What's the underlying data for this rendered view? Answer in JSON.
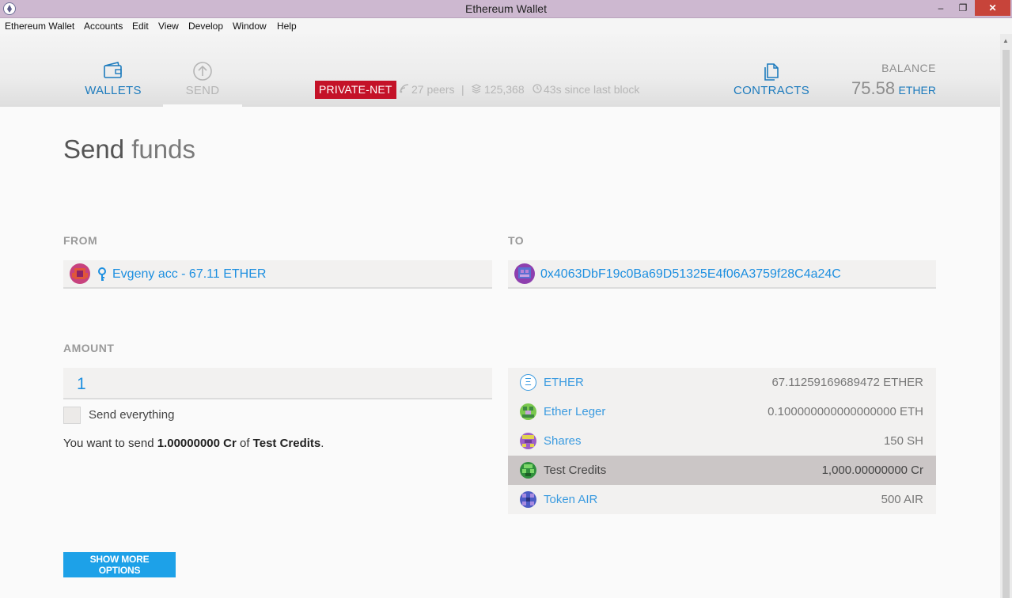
{
  "window": {
    "title": "Ethereum Wallet",
    "minimize": "–",
    "maximize": "❐",
    "close": "✕"
  },
  "menu": [
    "Ethereum Wallet",
    "Accounts",
    "Edit",
    "View",
    "Develop",
    "Window",
    "Help"
  ],
  "nav": {
    "wallets": "WALLETS",
    "send": "SEND",
    "contracts": "CONTRACTS"
  },
  "status": {
    "network": "PRIVATE-NET",
    "peers": "27 peers",
    "separator": "|",
    "block": "125,368",
    "last_block": "43s since last block"
  },
  "balance": {
    "label": "BALANCE",
    "value": "75.58",
    "unit": "ETHER"
  },
  "page": {
    "title_bold": "Send",
    "title_light": "funds"
  },
  "from": {
    "label": "FROM",
    "account": "Evgeny acc - 67.11 ETHER"
  },
  "to": {
    "label": "TO",
    "address": "0x4063DbF19c0Ba69D51325E4f06A3759f28C4a24C"
  },
  "amount": {
    "label": "AMOUNT",
    "value": "1",
    "send_everything": "Send everything",
    "summary_prefix": "You want to send ",
    "summary_amount": "1.00000000 Cr",
    "summary_mid": " of ",
    "summary_token": "Test Credits",
    "summary_suffix": "."
  },
  "tokens": [
    {
      "name": "ETHER",
      "value": "67.11259169689472 ETHER",
      "icon": "ether-icon",
      "selected": false
    },
    {
      "name": "Ether Leger",
      "value": "0.100000000000000000 ETH",
      "icon": "identicon-green",
      "selected": false
    },
    {
      "name": "Shares",
      "value": "150 SH",
      "icon": "identicon-purple",
      "selected": false
    },
    {
      "name": "Test Credits",
      "value": "1,000.00000000 Cr",
      "icon": "identicon-green-dark",
      "selected": true
    },
    {
      "name": "Token AIR",
      "value": "500 AIR",
      "icon": "identicon-blue",
      "selected": false
    }
  ],
  "buttons": {
    "more_options": "SHOW MORE OPTIONS"
  },
  "colors": {
    "accent": "#1d7bbd",
    "link": "#1d8fe0",
    "badge": "#c41228",
    "button": "#1da1e8",
    "selected_row": "#cbc6c6"
  }
}
